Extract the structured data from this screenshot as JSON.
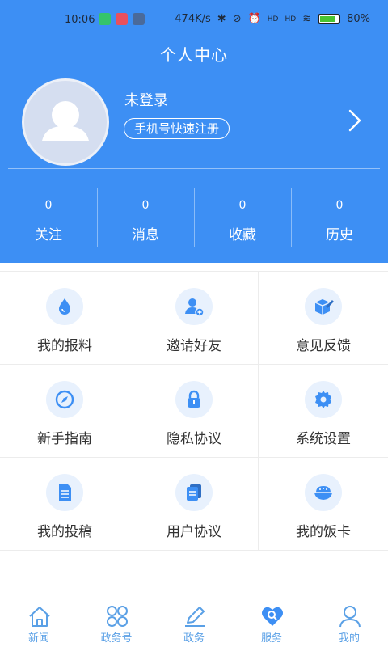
{
  "status_bar": {
    "time": "10:06",
    "network_speed": "474K/s",
    "signal_hd1": "HD",
    "signal_hd2": "HD",
    "battery": "80%"
  },
  "header": {
    "title": "个人中心",
    "login_status": "未登录",
    "register_button": "手机号快速注册"
  },
  "stats": [
    {
      "count": "0",
      "label": "关注"
    },
    {
      "count": "0",
      "label": "消息"
    },
    {
      "count": "0",
      "label": "收藏"
    },
    {
      "count": "0",
      "label": "历史"
    }
  ],
  "menu": [
    {
      "label": "我的报料",
      "icon": "droplet-icon"
    },
    {
      "label": "邀请好友",
      "icon": "add-user-icon"
    },
    {
      "label": "意见反馈",
      "icon": "feedback-box-icon"
    },
    {
      "label": "新手指南",
      "icon": "compass-icon"
    },
    {
      "label": "隐私协议",
      "icon": "lock-icon"
    },
    {
      "label": "系统设置",
      "icon": "gear-icon"
    },
    {
      "label": "我的投稿",
      "icon": "document-icon"
    },
    {
      "label": "用户协议",
      "icon": "agreement-icon"
    },
    {
      "label": "我的饭卡",
      "icon": "rice-bowl-icon"
    }
  ],
  "tabs": [
    {
      "label": "新闻",
      "icon": "home-icon"
    },
    {
      "label": "政务号",
      "icon": "clover-icon"
    },
    {
      "label": "政务",
      "icon": "pencil-icon"
    },
    {
      "label": "服务",
      "icon": "heart-search-icon"
    },
    {
      "label": "我的",
      "icon": "person-icon"
    }
  ],
  "colors": {
    "header_bg": "#3d8ff4",
    "icon_blue": "#3d8ff4",
    "icon_bg": "#e8f1fd",
    "tab_blue": "#5aa0e6",
    "battery_green": "#49c431"
  }
}
